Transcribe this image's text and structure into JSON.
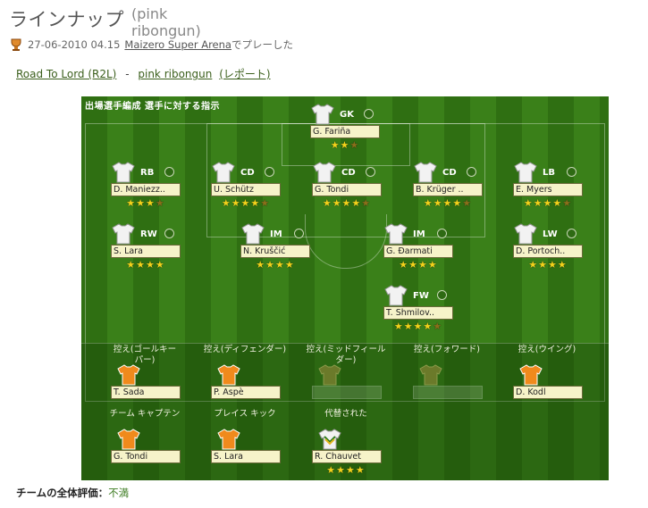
{
  "page": {
    "title": "ラインナップ",
    "subtitle": "(pink ribongun)",
    "meta_prefix": "27-06-2010 04.15",
    "arena": "Maizero Super Arena",
    "meta_suffix": "でプレーした",
    "crumbs": [
      {
        "label": "Road To Lord (R2L)"
      },
      {
        "sep": "-"
      },
      {
        "label": "pink ribongun"
      },
      {
        "label": "(レポート)"
      }
    ]
  },
  "field": {
    "header": "出場選手編成  選手に対する指示",
    "players": [
      {
        "pos": "GK",
        "name": "G. Fariña",
        "stars": 2.5,
        "shirt": "white"
      },
      {
        "pos": "RB",
        "name": "D. Maniezz..",
        "stars": 3.5,
        "shirt": "white"
      },
      {
        "pos": "CD",
        "name": "U. Schütz",
        "stars": 4.5,
        "shirt": "white"
      },
      {
        "pos": "CD",
        "name": "G. Tondi",
        "stars": 4.5,
        "shirt": "white"
      },
      {
        "pos": "CD",
        "name": "B. Krüger ..",
        "stars": 4.5,
        "shirt": "white"
      },
      {
        "pos": "LB",
        "name": "E. Myers",
        "stars": 4.5,
        "shirt": "white"
      },
      {
        "pos": "RW",
        "name": "S. Lara",
        "stars": 4,
        "shirt": "white"
      },
      {
        "pos": "IM",
        "name": "N. Kruščić",
        "stars": 4,
        "shirt": "white"
      },
      {
        "pos": "IM",
        "name": "G. Ðarmati",
        "stars": 4,
        "shirt": "white"
      },
      {
        "pos": "LW",
        "name": "D. Portoch..",
        "stars": 4,
        "shirt": "white"
      },
      {
        "pos": "FW",
        "name": "T. Shmilov..",
        "stars": 4.5,
        "shirt": "white"
      }
    ],
    "subs_row1": [
      {
        "label": "控え(ゴールキー\nパー)",
        "name": "T. Sada",
        "shirt": "orange"
      },
      {
        "label": "控え(ディフェンダー)",
        "name": "P. Aspè",
        "shirt": "orange"
      },
      {
        "label": "控え(ミッドフィール\nダー)",
        "name": "",
        "shirt": "empty"
      },
      {
        "label": "控え(フォワード)",
        "name": "",
        "shirt": "empty"
      },
      {
        "label": "控え(ウイング)",
        "name": "D. Kodl",
        "shirt": "orange"
      }
    ],
    "subs_row2": [
      {
        "label": "チーム キャプテン",
        "name": "G. Tondi",
        "shirt": "orange"
      },
      {
        "label": "プレイス キック",
        "name": "S. Lara",
        "shirt": "orange"
      },
      {
        "label": "代替された",
        "name": "R. Chauvet",
        "shirt": "gk",
        "stars": 4
      }
    ]
  },
  "rating": {
    "label": "チームの全体評価：",
    "value": "不満"
  },
  "colors": {
    "field_dark": "#2f6f12",
    "field_light": "#3a8019",
    "star": "#f3d21a",
    "link": "#3b5f1c"
  }
}
